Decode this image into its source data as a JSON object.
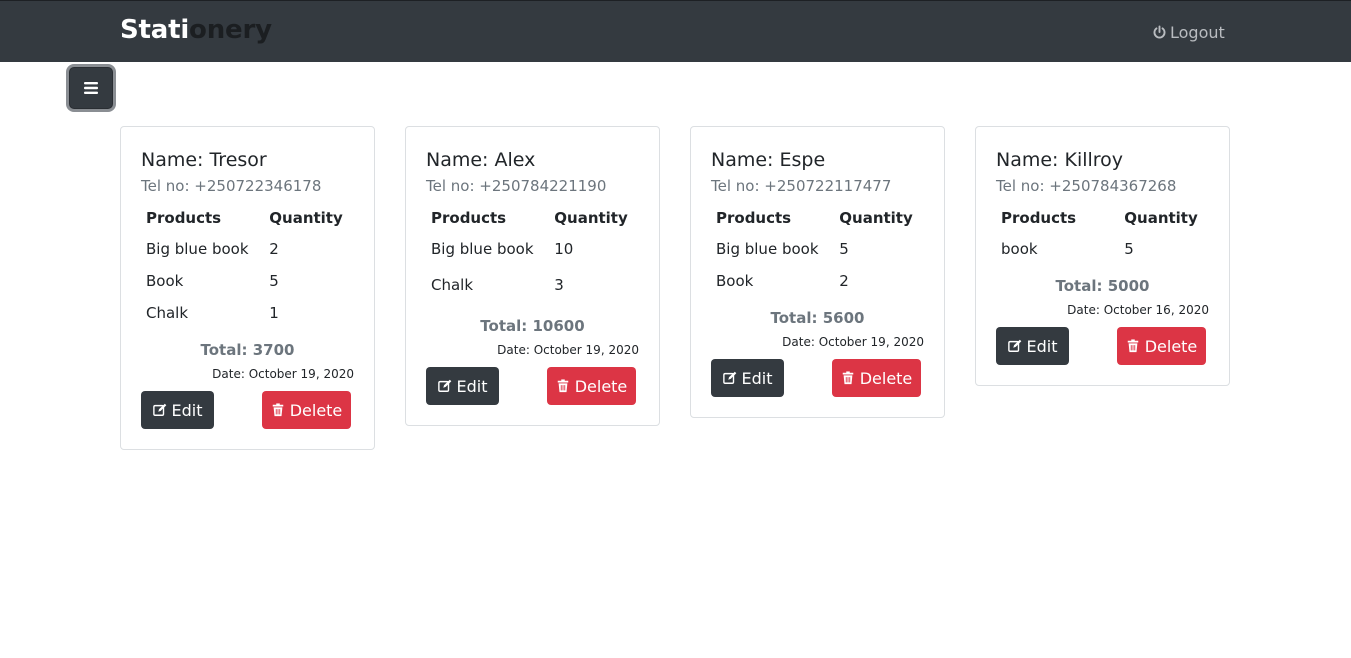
{
  "navbar": {
    "brand_part1": "Stati",
    "brand_part2": "onery",
    "logout_label": "Logout",
    "logout_icon": "power-icon"
  },
  "sidebar_toggle": {
    "icon": "hamburger-icon"
  },
  "table_headers": {
    "products": "Products",
    "quantity": "Quantity"
  },
  "buttons": {
    "edit": "Edit",
    "delete": "Delete"
  },
  "colors": {
    "navbar": "#343a40",
    "danger": "#dc3545",
    "muted": "#6c757d"
  },
  "orders": [
    {
      "name": "Name: Tresor",
      "tel": "Tel no: +250722346178",
      "items": [
        {
          "product": "Big blue book",
          "quantity": "2"
        },
        {
          "product": "Book",
          "quantity": "5"
        },
        {
          "product": "Chalk",
          "quantity": "1"
        }
      ],
      "total": "Total: 3700",
      "date": "Date: October 19, 2020"
    },
    {
      "name": "Name: Alex",
      "tel": "Tel no: +250784221190",
      "items": [
        {
          "product": "Big blue book",
          "quantity": "10"
        },
        {
          "product": "Chalk",
          "quantity": "3"
        }
      ],
      "total": "Total: 10600",
      "date": "Date: October 19, 2020"
    },
    {
      "name": "Name: Espe",
      "tel": "Tel no: +250722117477",
      "items": [
        {
          "product": "Big blue book",
          "quantity": "5"
        },
        {
          "product": "Book",
          "quantity": "2"
        }
      ],
      "total": "Total: 5600",
      "date": "Date: October 19, 2020"
    },
    {
      "name": "Name: Killroy",
      "tel": "Tel no: +250784367268",
      "items": [
        {
          "product": "book",
          "quantity": "5"
        }
      ],
      "total": "Total: 5000",
      "date": "Date: October 16, 2020"
    }
  ]
}
